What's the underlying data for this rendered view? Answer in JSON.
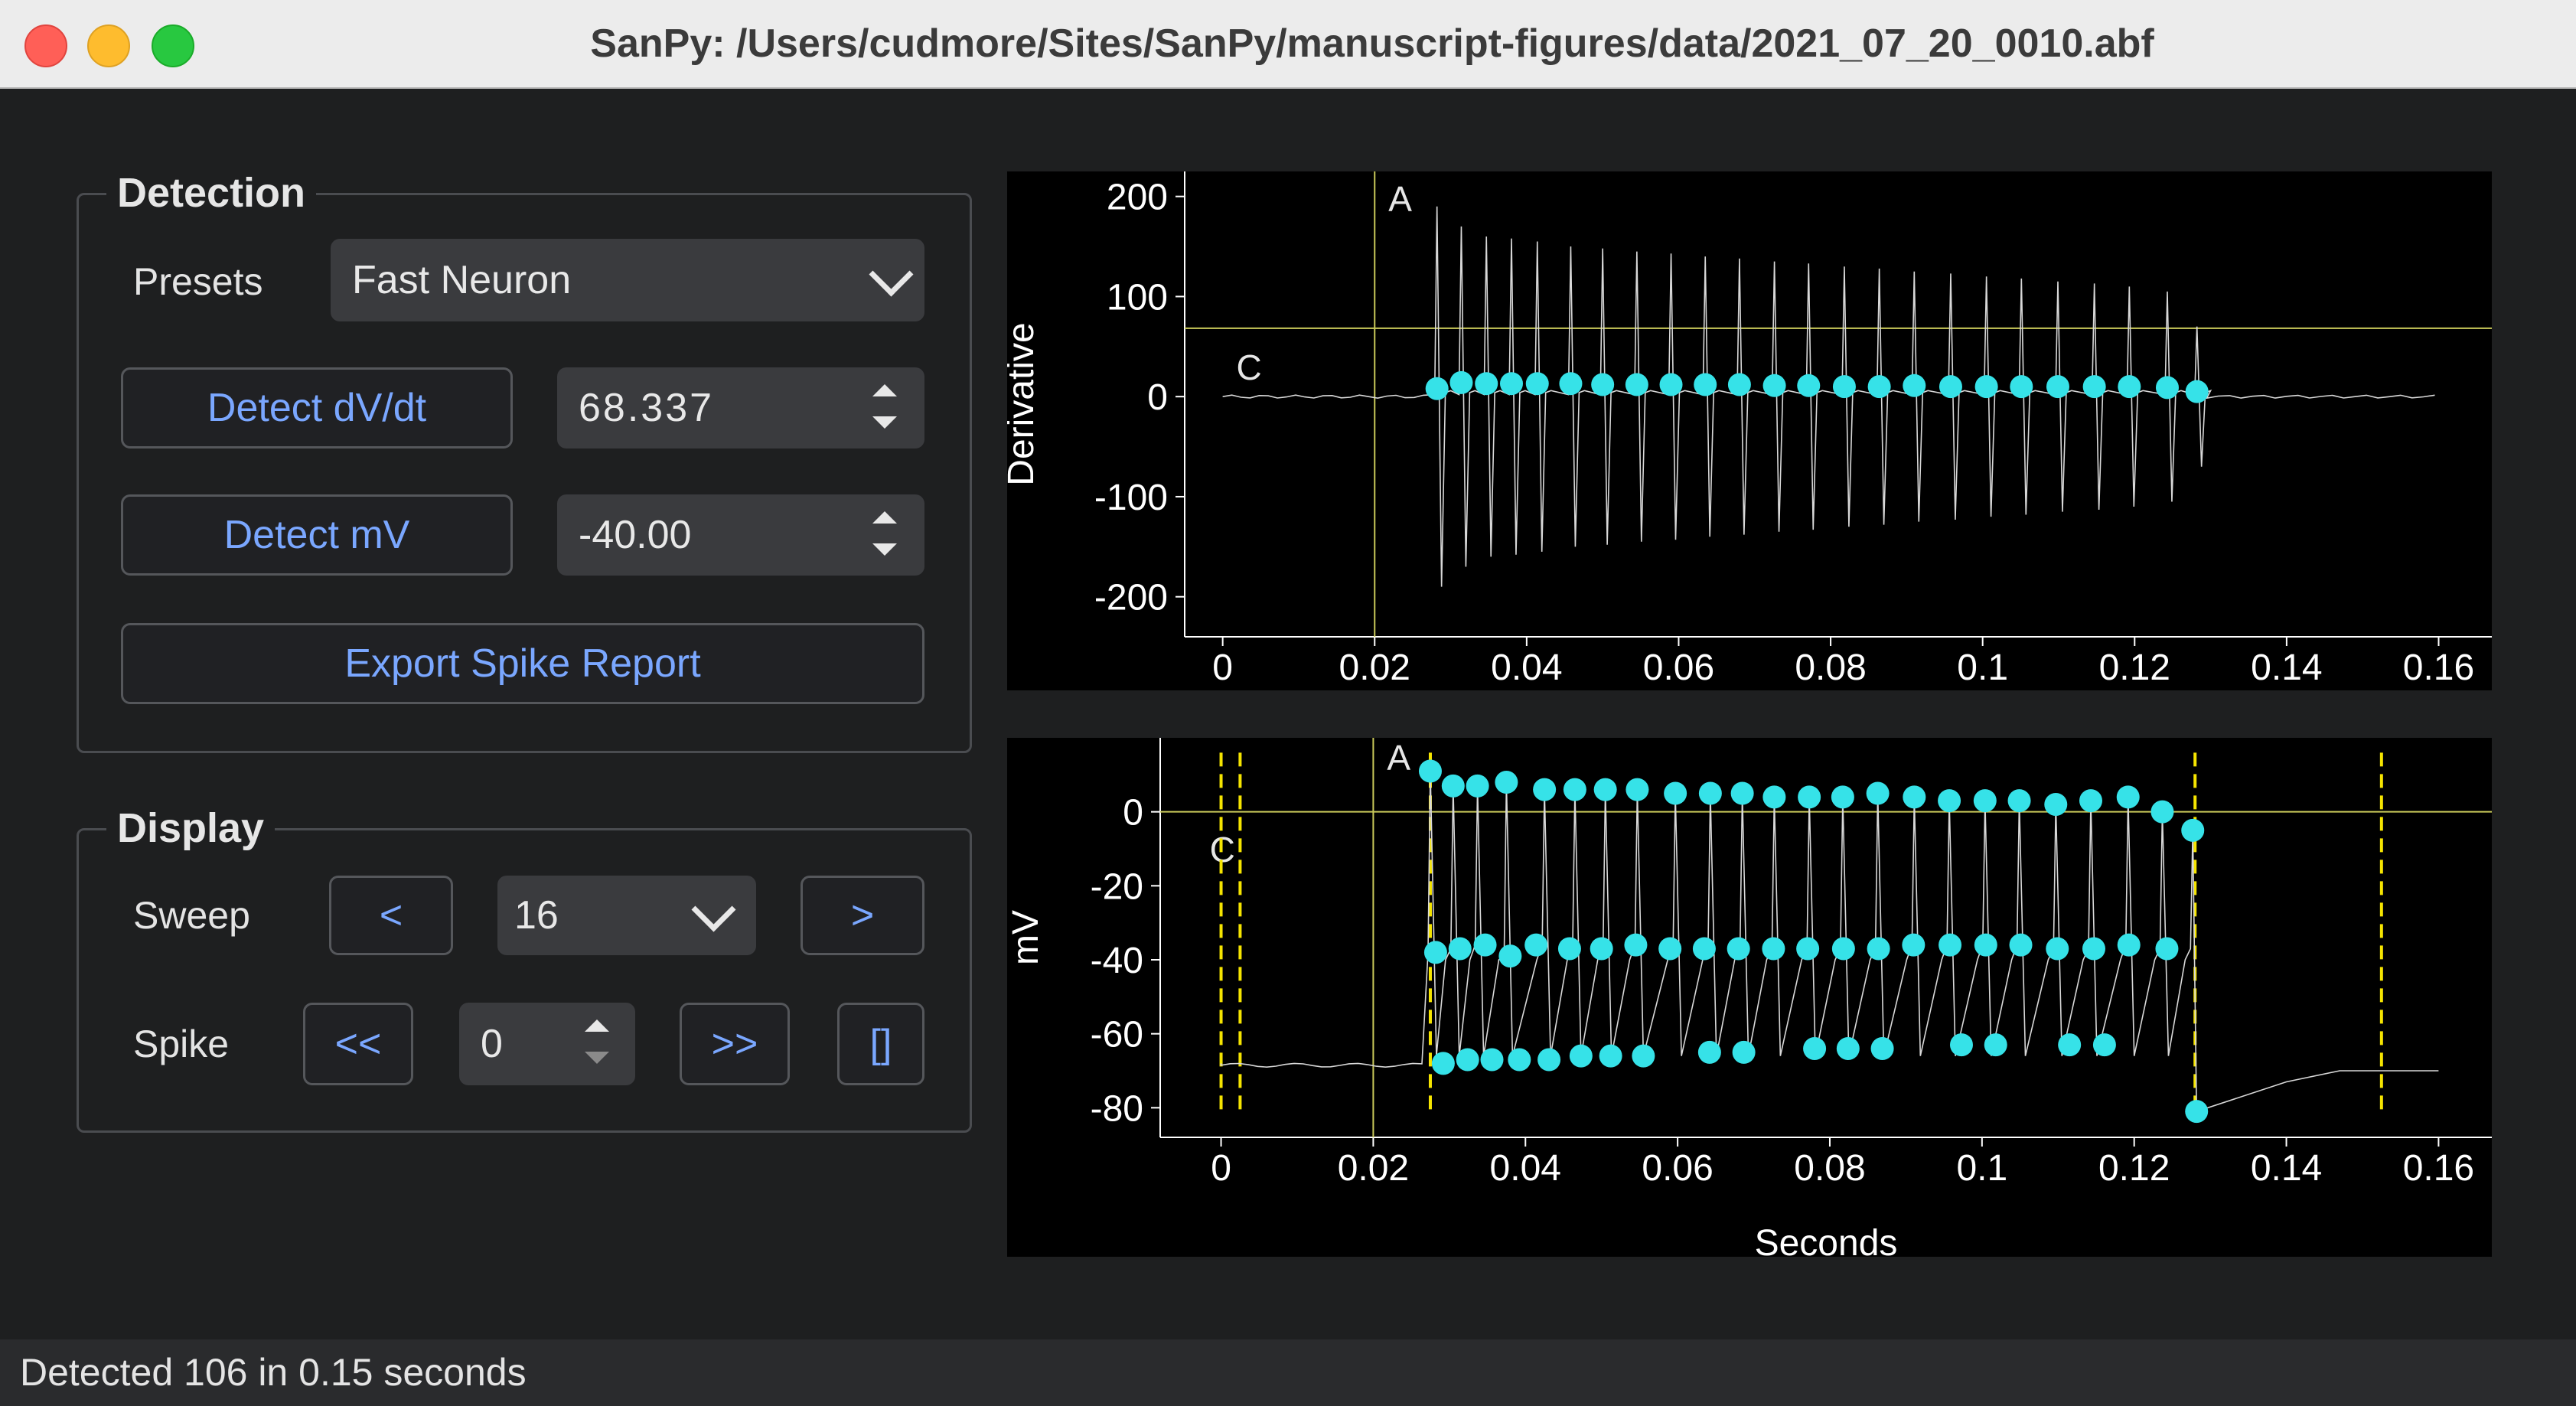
{
  "window": {
    "title": "SanPy: /Users/cudmore/Sites/SanPy/manuscript-figures/data/2021_07_20_0010.abf"
  },
  "detection": {
    "title": "Detection",
    "presets_label": "Presets",
    "preset_value": "Fast Neuron",
    "dvdt_button": "Detect dV/dt",
    "dvdt_value": "68.337",
    "mv_button": "Detect mV",
    "mv_value": "-40.00",
    "export_button": "Export Spike Report"
  },
  "display": {
    "title": "Display",
    "sweep_label": "Sweep",
    "sweep_prev": "<",
    "sweep_value": "16",
    "sweep_next": ">",
    "spike_label": "Spike",
    "spike_prev": "<<",
    "spike_value": "0",
    "spike_next": ">>",
    "spike_select": "[]"
  },
  "status": {
    "text": "Detected 106 in 0.15 seconds"
  },
  "chart_data": [
    {
      "type": "line",
      "ylabel": "Derivative",
      "xlabel": "",
      "xlim": [
        -0.005,
        0.167
      ],
      "ylim": [
        -240,
        225
      ],
      "x_ticks": [
        "0",
        "0.02",
        "0.04",
        "0.06",
        "0.08",
        "0.1",
        "0.12",
        "0.14",
        "0.16"
      ],
      "x_tick_values": [
        0,
        0.02,
        0.04,
        0.06,
        0.08,
        0.1,
        0.12,
        0.14,
        0.16
      ],
      "y_ticks": [
        "200",
        "100",
        "0",
        "-100",
        "-200"
      ],
      "y_tick_values": [
        200,
        100,
        0,
        -100,
        -200
      ],
      "threshold_line": 68.337,
      "cursor_lines": [
        0.02
      ],
      "cursor_labels": [
        "A",
        "C"
      ],
      "spike_times": [
        0.0282,
        0.0314,
        0.0347,
        0.038,
        0.0414,
        0.0458,
        0.05,
        0.0545,
        0.059,
        0.0635,
        0.068,
        0.0726,
        0.0771,
        0.0818,
        0.0864,
        0.091,
        0.0958,
        0.1005,
        0.1051,
        0.1099,
        0.1147,
        0.1193,
        0.1243,
        0.1282
      ],
      "spike_peaks": [
        190,
        170,
        160,
        158,
        155,
        150,
        148,
        145,
        143,
        140,
        138,
        135,
        133,
        130,
        128,
        125,
        123,
        120,
        118,
        115,
        113,
        110,
        105,
        70
      ],
      "marker_values": [
        8,
        14,
        13,
        13,
        13,
        13,
        12,
        12,
        12,
        12,
        12,
        11,
        11,
        10,
        10,
        11,
        10,
        10,
        10,
        10,
        10,
        10,
        9,
        5
      ],
      "marker_color": "#36e2e8"
    },
    {
      "type": "line",
      "ylabel": "mV",
      "xlabel": "Seconds",
      "xlim": [
        -0.008,
        0.167
      ],
      "ylim": [
        -88,
        20
      ],
      "x_ticks": [
        "0",
        "0.02",
        "0.04",
        "0.06",
        "0.08",
        "0.1",
        "0.12",
        "0.14",
        "0.16"
      ],
      "x_tick_values": [
        0,
        0.02,
        0.04,
        0.06,
        0.08,
        0.1,
        0.12,
        0.14,
        0.16
      ],
      "y_ticks": [
        "0",
        "-20",
        "-40",
        "-60",
        "-80"
      ],
      "y_tick_values": [
        0,
        -20,
        -40,
        -60,
        -80
      ],
      "threshold_line": 0,
      "cursor_lines": [
        0.02
      ],
      "cursor_labels": [
        "A",
        "C"
      ],
      "dashed_lines": [
        0.0,
        0.0025,
        0.0275,
        0.128,
        0.1525
      ],
      "peaks": {
        "x": [
          0.0275,
          0.0305,
          0.0337,
          0.0375,
          0.0425,
          0.0465,
          0.0505,
          0.0547,
          0.0597,
          0.0643,
          0.0685,
          0.0727,
          0.0773,
          0.0817,
          0.0863,
          0.0911,
          0.0957,
          0.1004,
          0.1049,
          0.1097,
          0.1143,
          0.1192,
          0.1237,
          0.1277
        ],
        "y": [
          11,
          7,
          7,
          8,
          6,
          6,
          6,
          6,
          5,
          5,
          5,
          4,
          4,
          4,
          5,
          4,
          3,
          3,
          3,
          2,
          3,
          4,
          0,
          -5
        ]
      },
      "thresholds": {
        "x": [
          0.0282,
          0.0314,
          0.0347,
          0.038,
          0.0414,
          0.0458,
          0.05,
          0.0545,
          0.059,
          0.0635,
          0.068,
          0.0726,
          0.0771,
          0.0818,
          0.0864,
          0.091,
          0.0958,
          0.1005,
          0.1051,
          0.1099,
          0.1147,
          0.1193,
          0.1243
        ],
        "y": [
          -38,
          -37,
          -36,
          -39,
          -36,
          -37,
          -37,
          -36,
          -37,
          -37,
          -37,
          -37,
          -37,
          -37,
          -37,
          -36,
          -36,
          -36,
          -36,
          -37,
          -37,
          -36,
          -37
        ]
      },
      "troughs": {
        "x": [
          0.0292,
          0.0324,
          0.0356,
          0.0392,
          0.0431,
          0.0473,
          0.0512,
          0.0555,
          0.0642,
          0.0687,
          0.078,
          0.0824,
          0.0869,
          0.0973,
          0.1018,
          0.1115,
          0.1161
        ],
        "y": [
          -68,
          -67,
          -67,
          -67,
          -67,
          -66,
          -66,
          -66,
          -65,
          -65,
          -64,
          -64,
          -64,
          -63,
          -63,
          -63,
          -63
        ]
      },
      "end_trough": {
        "x": 0.1282,
        "y": -81
      },
      "marker_color": "#36e2e8"
    }
  ]
}
